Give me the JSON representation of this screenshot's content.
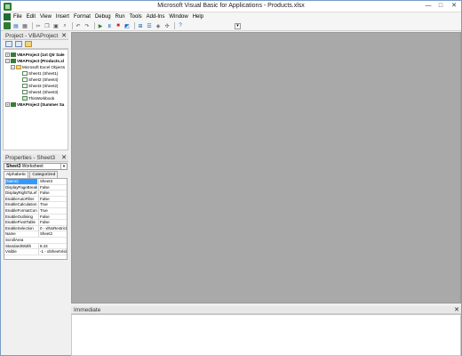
{
  "window": {
    "title": "Microsoft Visual Basic for Applications - Products.xlsx",
    "minimize": "—",
    "maximize": "□",
    "close": "✕"
  },
  "menu": [
    "File",
    "Edit",
    "View",
    "Insert",
    "Format",
    "Debug",
    "Run",
    "Tools",
    "Add-Ins",
    "Window",
    "Help"
  ],
  "project": {
    "title": "Project - VBAProject",
    "close": "✕",
    "tree": {
      "p1": "VBAProject (1st Qtr Sale",
      "p2": "VBAProject (Products.xl",
      "folder": "Microsoft Excel Objects",
      "s1": "Sheet1 (Sheet1)",
      "s2": "Sheet2 (Sheet4)",
      "s3": "Sheet3 (Sheet2)",
      "s4": "Sheet4 (Sheet3)",
      "wb": "ThisWorkbook",
      "p3": "VBAProject (Summer Sa"
    }
  },
  "properties": {
    "title": "Properties - Sheet3",
    "close": "✕",
    "object_name": "Sheet3",
    "object_type": "Worksheet",
    "tabs": [
      "Alphabetic",
      "Categorized"
    ],
    "rows": [
      {
        "name": "(Name)",
        "value": "Sheet3"
      },
      {
        "name": "DisplayPageBreak",
        "value": "False"
      },
      {
        "name": "DisplayRightToLef",
        "value": "False"
      },
      {
        "name": "EnableAutoFilter",
        "value": "False"
      },
      {
        "name": "EnableCalculation",
        "value": "True"
      },
      {
        "name": "EnableFormatCon",
        "value": "True"
      },
      {
        "name": "EnableOutlining",
        "value": "False"
      },
      {
        "name": "EnablePivotTable",
        "value": "False"
      },
      {
        "name": "EnableSelection",
        "value": "0 - xlNoRestrict"
      },
      {
        "name": "Name",
        "value": "Sheet2"
      },
      {
        "name": "ScrollArea",
        "value": ""
      },
      {
        "name": "StandardWidth",
        "value": "8.43"
      },
      {
        "name": "Visible",
        "value": "-1 - xlSheetVisib"
      }
    ]
  },
  "immediate": {
    "title": "Immediate",
    "close": "✕"
  }
}
